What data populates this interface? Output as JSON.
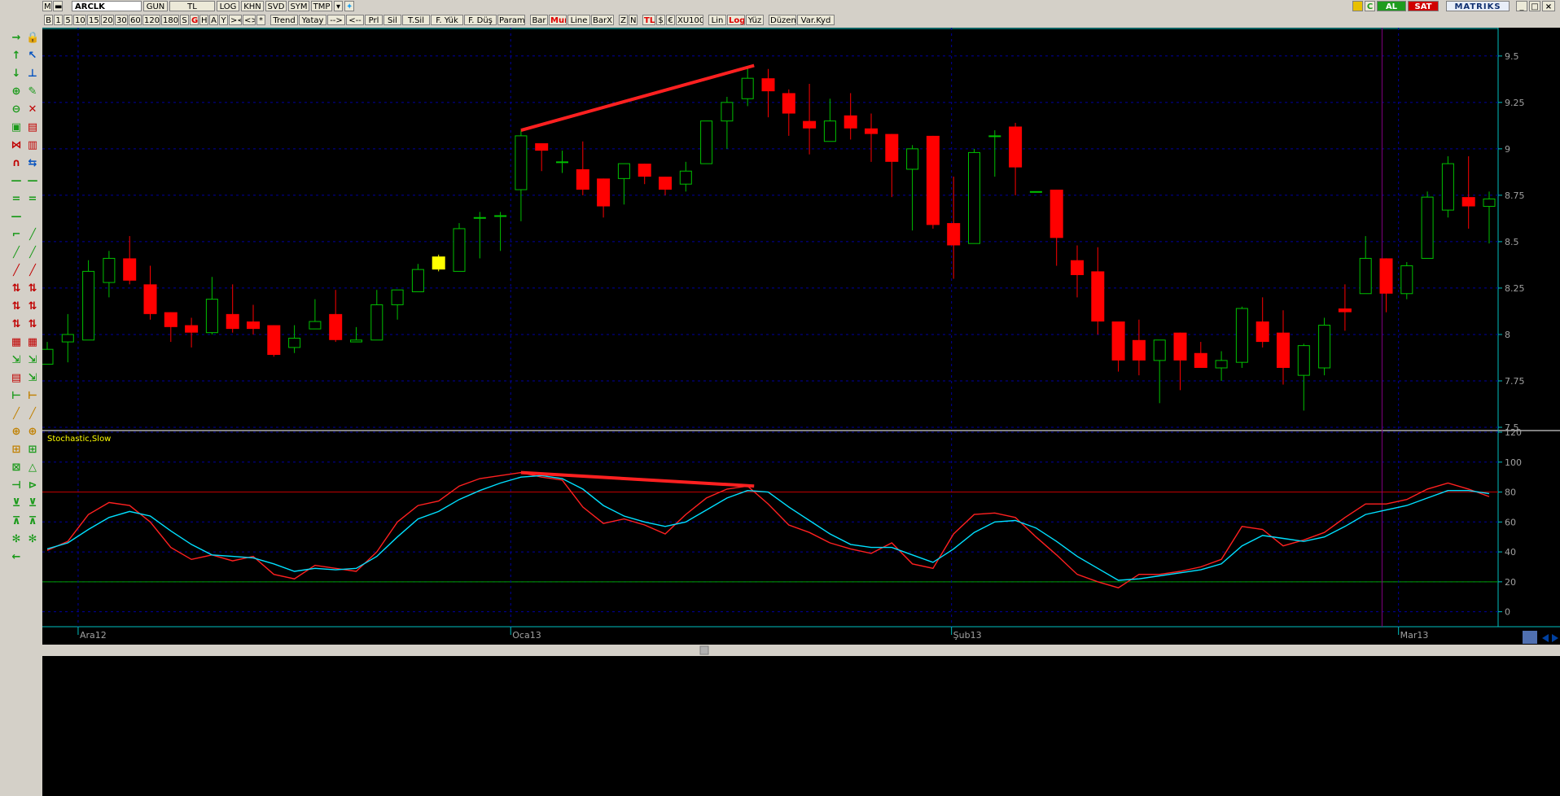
{
  "symbol": "ARCLK",
  "toolbar_top": {
    "period": "GUN",
    "currency": "TL",
    "log": "LOG",
    "khn": "KHN",
    "svd": "SVD",
    "sym": "SYM",
    "tmp": "TMP",
    "al": "AL",
    "sat": "SAT",
    "brand": "MATRIKS"
  },
  "toolbar_second": [
    "B",
    "1",
    "5",
    "10",
    "15",
    "20",
    "30",
    "60",
    "120",
    "180",
    "S",
    "G",
    "H",
    "A",
    "Y",
    "><",
    "<>",
    "*",
    "Trend",
    "Yatay",
    "-->",
    "<--",
    "Prl",
    "Sil",
    "T.Sil",
    "F. Yük",
    "F. Düş",
    "Param",
    "Bar",
    "Mum",
    "Line",
    "BarX",
    "Z",
    "N",
    "TL",
    "$",
    "€",
    "XU100",
    "Lin",
    "Log",
    "Yüz",
    "Düzen",
    "Var.Kyd"
  ],
  "colors": {
    "up": "#00c000",
    "down": "#ff0000",
    "grid": "#0000a0",
    "axis": "#00c0c0",
    "stoch_k": "#ff2020",
    "stoch_d": "#00e0ff",
    "trendline": "#ff2020",
    "highlight": "#ffff00"
  },
  "indicator_label": "Stochastic,Slow",
  "chart_data": [
    {
      "type": "candlestick",
      "yticks": [
        "9.5",
        "9.25",
        "9",
        "8.75",
        "8.5",
        "8.25",
        "8",
        "7.75",
        "7.5"
      ],
      "xlabels": [
        "Ara12",
        "Oca13",
        "Şub13",
        "Mar13"
      ],
      "ylim": [
        7.5,
        9.6
      ],
      "candles": [
        {
          "o": 7.84,
          "h": 7.96,
          "l": 7.84,
          "c": 7.92
        },
        {
          "o": 7.96,
          "h": 8.11,
          "l": 7.85,
          "c": 8.0
        },
        {
          "o": 7.97,
          "h": 8.4,
          "l": 7.97,
          "c": 8.34
        },
        {
          "o": 8.28,
          "h": 8.45,
          "l": 8.2,
          "c": 8.41
        },
        {
          "o": 8.41,
          "h": 8.53,
          "l": 8.27,
          "c": 8.29
        },
        {
          "o": 8.27,
          "h": 8.37,
          "l": 8.08,
          "c": 8.11
        },
        {
          "o": 8.12,
          "h": 8.12,
          "l": 7.96,
          "c": 8.04
        },
        {
          "o": 8.05,
          "h": 8.09,
          "l": 7.93,
          "c": 8.01
        },
        {
          "o": 8.01,
          "h": 8.31,
          "l": 8.0,
          "c": 8.19
        },
        {
          "o": 8.11,
          "h": 8.27,
          "l": 8.01,
          "c": 8.03
        },
        {
          "o": 8.07,
          "h": 8.16,
          "l": 8.0,
          "c": 8.03
        },
        {
          "o": 8.05,
          "h": 8.05,
          "l": 7.88,
          "c": 7.89
        },
        {
          "o": 7.93,
          "h": 8.05,
          "l": 7.9,
          "c": 7.98
        },
        {
          "o": 8.03,
          "h": 8.19,
          "l": 8.03,
          "c": 8.07
        },
        {
          "o": 8.11,
          "h": 8.24,
          "l": 7.96,
          "c": 7.97
        },
        {
          "o": 7.96,
          "h": 8.04,
          "l": 7.96,
          "c": 7.97
        },
        {
          "o": 7.97,
          "h": 8.24,
          "l": 7.97,
          "c": 8.16
        },
        {
          "o": 8.16,
          "h": 8.24,
          "l": 8.08,
          "c": 8.24
        },
        {
          "o": 8.23,
          "h": 8.38,
          "l": 8.23,
          "c": 8.35
        },
        {
          "o": 8.35,
          "h": 8.43,
          "l": 8.34,
          "c": 8.42
        },
        {
          "o": 8.34,
          "h": 8.6,
          "l": 8.34,
          "c": 8.57
        },
        {
          "o": 8.63,
          "h": 8.66,
          "l": 8.41,
          "c": 8.63
        },
        {
          "o": 8.64,
          "h": 8.66,
          "l": 8.45,
          "c": 8.64
        },
        {
          "o": 8.78,
          "h": 9.1,
          "l": 8.61,
          "c": 9.07
        },
        {
          "o": 9.03,
          "h": 9.03,
          "l": 8.88,
          "c": 8.99
        },
        {
          "o": 8.93,
          "h": 8.99,
          "l": 8.87,
          "c": 8.93
        },
        {
          "o": 8.89,
          "h": 9.04,
          "l": 8.75,
          "c": 8.78
        },
        {
          "o": 8.84,
          "h": 8.84,
          "l": 8.63,
          "c": 8.69
        },
        {
          "o": 8.84,
          "h": 8.92,
          "l": 8.7,
          "c": 8.92
        },
        {
          "o": 8.92,
          "h": 8.92,
          "l": 8.81,
          "c": 8.85
        },
        {
          "o": 8.85,
          "h": 8.85,
          "l": 8.75,
          "c": 8.78
        },
        {
          "o": 8.81,
          "h": 8.93,
          "l": 8.77,
          "c": 8.88
        },
        {
          "o": 8.92,
          "h": 9.14,
          "l": 8.92,
          "c": 9.15
        },
        {
          "o": 9.15,
          "h": 9.28,
          "l": 9.0,
          "c": 9.25
        },
        {
          "o": 9.27,
          "h": 9.44,
          "l": 9.23,
          "c": 9.38
        },
        {
          "o": 9.38,
          "h": 9.43,
          "l": 9.17,
          "c": 9.31
        },
        {
          "o": 9.3,
          "h": 9.32,
          "l": 9.07,
          "c": 9.19
        },
        {
          "o": 9.15,
          "h": 9.35,
          "l": 8.97,
          "c": 9.11
        },
        {
          "o": 9.04,
          "h": 9.27,
          "l": 9.04,
          "c": 9.15
        },
        {
          "o": 9.18,
          "h": 9.3,
          "l": 9.05,
          "c": 9.11
        },
        {
          "o": 9.11,
          "h": 9.19,
          "l": 8.93,
          "c": 9.08
        },
        {
          "o": 9.08,
          "h": 9.08,
          "l": 8.74,
          "c": 8.93
        },
        {
          "o": 8.89,
          "h": 9.02,
          "l": 8.56,
          "c": 9.0
        },
        {
          "o": 9.07,
          "h": 9.07,
          "l": 8.57,
          "c": 8.59
        },
        {
          "o": 8.6,
          "h": 8.85,
          "l": 8.3,
          "c": 8.48
        },
        {
          "o": 8.49,
          "h": 9.0,
          "l": 8.49,
          "c": 8.98
        },
        {
          "o": 9.07,
          "h": 9.1,
          "l": 8.85,
          "c": 9.07
        },
        {
          "o": 9.12,
          "h": 9.14,
          "l": 8.75,
          "c": 8.9
        },
        {
          "o": 8.77,
          "h": 8.77,
          "l": 8.77,
          "c": 8.77
        },
        {
          "o": 8.78,
          "h": 8.78,
          "l": 8.37,
          "c": 8.52
        },
        {
          "o": 8.4,
          "h": 8.48,
          "l": 8.2,
          "c": 8.32
        },
        {
          "o": 8.34,
          "h": 8.47,
          "l": 8.0,
          "c": 8.07
        },
        {
          "o": 8.07,
          "h": 8.07,
          "l": 7.8,
          "c": 7.86
        },
        {
          "o": 7.97,
          "h": 8.08,
          "l": 7.78,
          "c": 7.86
        },
        {
          "o": 7.86,
          "h": 7.97,
          "l": 7.63,
          "c": 7.97
        },
        {
          "o": 8.01,
          "h": 8.01,
          "l": 7.7,
          "c": 7.86
        },
        {
          "o": 7.9,
          "h": 7.96,
          "l": 7.82,
          "c": 7.82
        },
        {
          "o": 7.82,
          "h": 7.91,
          "l": 7.75,
          "c": 7.86
        },
        {
          "o": 7.85,
          "h": 8.15,
          "l": 7.82,
          "c": 8.14
        },
        {
          "o": 8.07,
          "h": 8.2,
          "l": 7.93,
          "c": 7.96
        },
        {
          "o": 8.01,
          "h": 8.13,
          "l": 7.73,
          "c": 7.82
        },
        {
          "o": 7.78,
          "h": 7.95,
          "l": 7.59,
          "c": 7.94
        },
        {
          "o": 7.82,
          "h": 8.09,
          "l": 7.78,
          "c": 8.05
        },
        {
          "o": 8.14,
          "h": 8.27,
          "l": 8.02,
          "c": 8.12
        },
        {
          "o": 8.22,
          "h": 8.53,
          "l": 8.22,
          "c": 8.41
        },
        {
          "o": 8.41,
          "h": 8.41,
          "l": 8.12,
          "c": 8.22
        },
        {
          "o": 8.22,
          "h": 8.39,
          "l": 8.19,
          "c": 8.37
        },
        {
          "o": 8.41,
          "h": 8.77,
          "l": 8.41,
          "c": 8.74
        },
        {
          "o": 8.67,
          "h": 8.96,
          "l": 8.63,
          "c": 8.92
        },
        {
          "o": 8.74,
          "h": 8.96,
          "l": 8.57,
          "c": 8.69
        },
        {
          "o": 8.69,
          "h": 8.77,
          "l": 8.49,
          "c": 8.73
        }
      ],
      "highlight_index": 19,
      "trendline_from_index": 23,
      "trendline_to_index": 34
    },
    {
      "type": "line",
      "name": "Stochastic,Slow",
      "yticks": [
        "120",
        "100",
        "80",
        "60",
        "40",
        "20",
        "0"
      ],
      "ylim": [
        -10,
        120
      ],
      "levels": [
        80,
        20
      ],
      "series": [
        {
          "values": [
            41,
            47,
            65,
            73,
            71,
            60,
            43,
            35,
            38,
            34,
            37,
            25,
            22,
            31,
            29,
            27,
            40,
            60,
            71,
            74,
            84,
            89,
            91,
            93,
            90,
            88,
            70,
            59,
            62,
            58,
            52,
            65,
            76,
            82,
            84,
            72,
            58,
            53,
            46,
            42,
            39,
            46,
            32,
            29,
            52,
            65,
            66,
            63,
            50,
            38,
            25,
            20,
            16,
            25,
            25,
            27,
            30,
            35,
            57,
            55,
            44,
            48,
            53,
            63,
            72,
            72,
            75,
            82,
            86,
            82,
            77
          ]
        },
        {
          "values": [
            42,
            46,
            55,
            63,
            67,
            64,
            54,
            45,
            38,
            37,
            36,
            32,
            27,
            29,
            28,
            29,
            37,
            50,
            62,
            67,
            75,
            81,
            86,
            90,
            91,
            89,
            82,
            71,
            64,
            60,
            57,
            60,
            68,
            76,
            81,
            80,
            70,
            61,
            52,
            45,
            43,
            43,
            38,
            33,
            42,
            53,
            60,
            61,
            56,
            47,
            37,
            29,
            21,
            22,
            24,
            26,
            28,
            32,
            44,
            51,
            49,
            47,
            50,
            57,
            65,
            68,
            71,
            76,
            81,
            81,
            79
          ]
        }
      ],
      "trendline_from_index": 23,
      "trendline_to_index": 34
    }
  ]
}
